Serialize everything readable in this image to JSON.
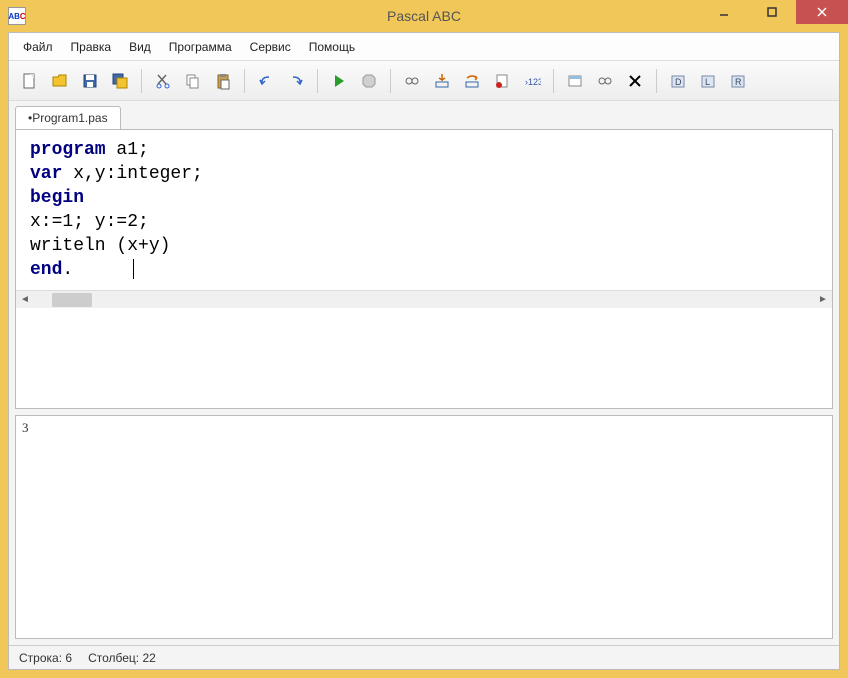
{
  "title": "Pascal ABC",
  "app_icon": {
    "a": "AB",
    "c": "C"
  },
  "menu": [
    "Файл",
    "Правка",
    "Вид",
    "Программа",
    "Сервис",
    "Помощь"
  ],
  "tab": {
    "label": "•Program1.pas"
  },
  "code_lines": [
    {
      "tokens": [
        {
          "t": "program",
          "k": true
        },
        {
          "t": " a1;",
          "k": false
        }
      ]
    },
    {
      "tokens": [
        {
          "t": "var",
          "k": true
        },
        {
          "t": " x,y:integer;",
          "k": false
        }
      ]
    },
    {
      "tokens": [
        {
          "t": "begin",
          "k": true
        }
      ]
    },
    {
      "tokens": [
        {
          "t": "x:=1; y:=2;",
          "k": false
        }
      ]
    },
    {
      "tokens": [
        {
          "t": "writeln (x+y)",
          "k": false
        }
      ]
    },
    {
      "tokens": [
        {
          "t": "end",
          "k": true
        },
        {
          "t": ".",
          "k": false
        }
      ]
    }
  ],
  "output": "3",
  "status": {
    "line_label": "Строка:",
    "line_val": "6",
    "col_label": "Столбец:",
    "col_val": "22"
  },
  "toolbar_icons": [
    "new",
    "open",
    "save",
    "save-all",
    "cut",
    "copy",
    "paste",
    "undo",
    "redo",
    "run",
    "stop",
    "watch",
    "step-into",
    "step-over",
    "breakpoint",
    "var-watch",
    "sub1",
    "sub2",
    "delete",
    "sub3",
    "sub4",
    "sub5"
  ]
}
